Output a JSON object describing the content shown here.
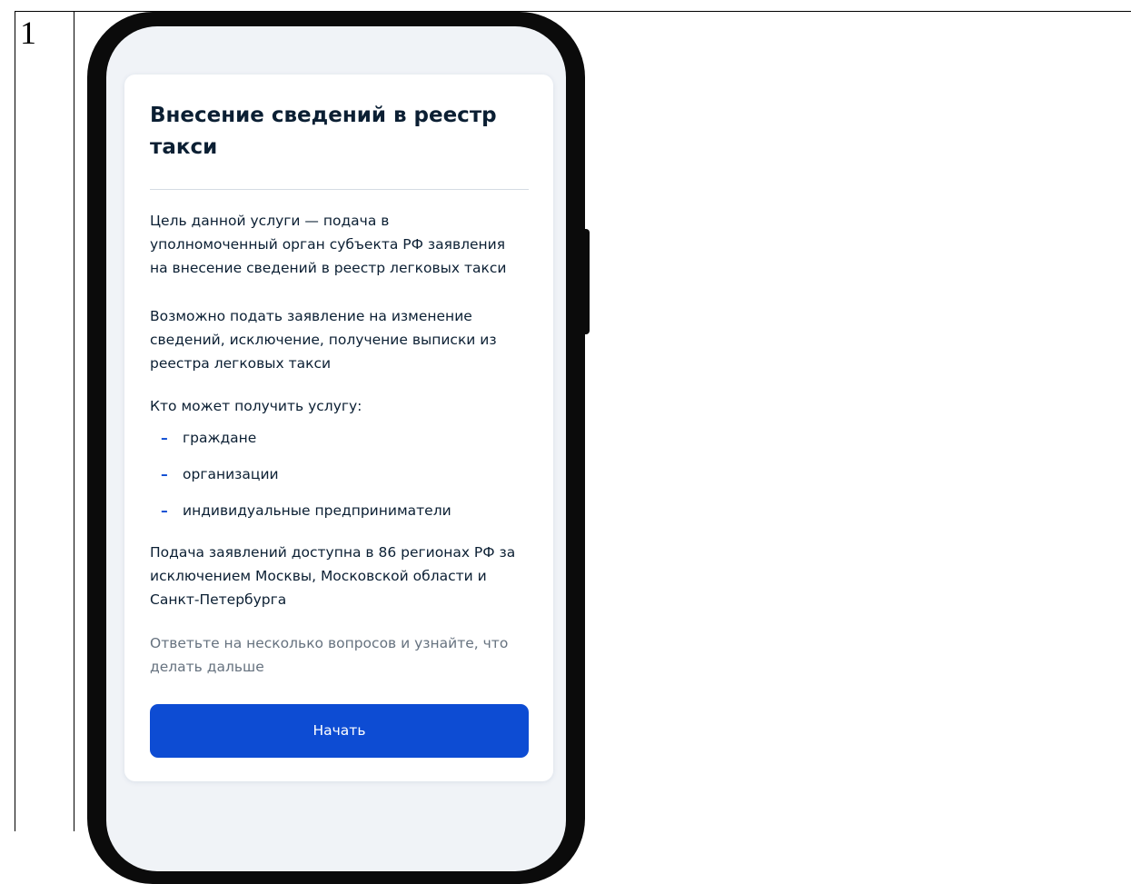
{
  "row": {
    "number": "1"
  },
  "card": {
    "title": "Внесение сведений в реестр такси",
    "paragraphs": [
      "Цель данной услуги — подача в\nуполномоченный орган субъекта РФ заявления\nна внесение сведений в реестр легковых такси",
      "Возможно подать заявление на изменение\nсведений, исключение, получение выписки из\nреестра легковых такси",
      "Кто может получить услугу:"
    ],
    "list_items": [
      "граждане",
      "организации",
      "индивидуальные предприниматели"
    ],
    "region_note": "Подача заявлений доступна в 86 регионах РФ за\nисключением Москвы, Московской области и\nСанкт-Петербурга",
    "hint": "Ответьте на несколько вопросов и узнайте, что\nделать дальше",
    "start_button_label": "Начать",
    "bullet_symbol": "–"
  },
  "colors": {
    "accent": "#0d4cd3",
    "text": "#0b1f33",
    "muted": "#66727f",
    "screen_background": "#f0f3f7"
  }
}
